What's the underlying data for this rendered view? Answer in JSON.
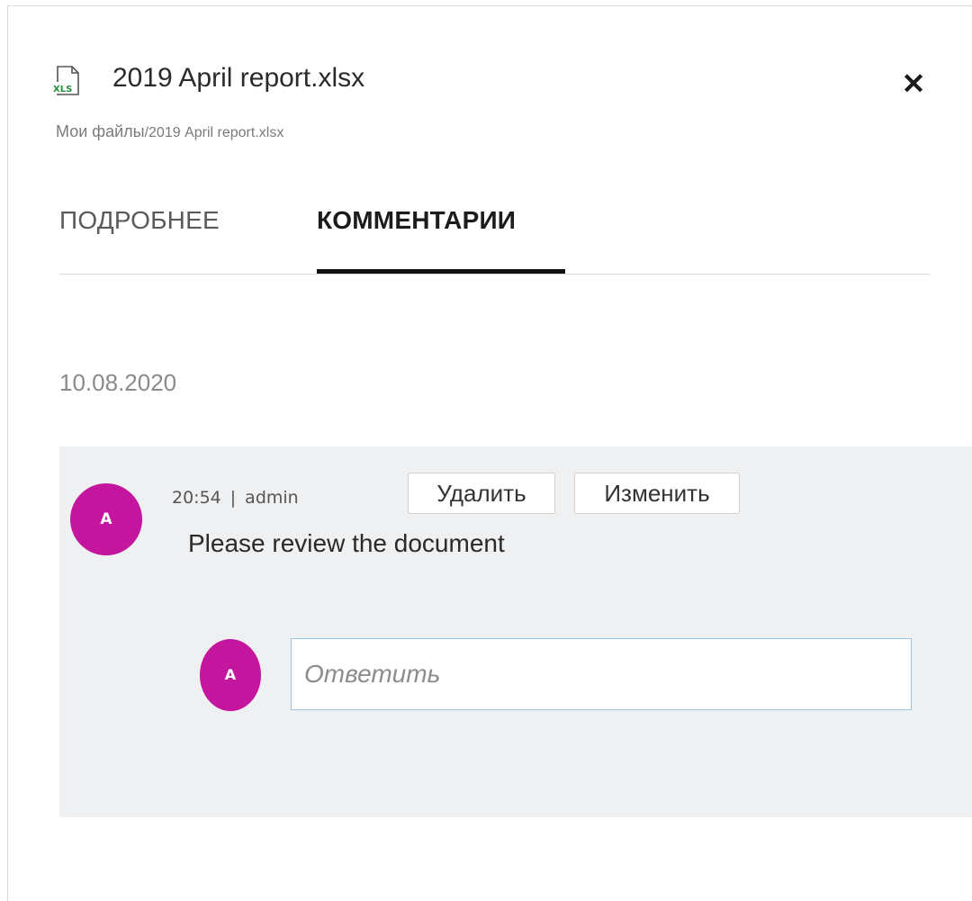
{
  "header": {
    "file_icon": "xls-file-icon",
    "file_icon_label": "XLS",
    "file_name": "2019 April report.xlsx",
    "close_icon": "close-icon"
  },
  "breadcrumb": {
    "root": "Мои файлы",
    "path": "/2019 April report.xlsx"
  },
  "tabs": [
    {
      "label": "ПОДРОБНЕЕ",
      "active": false
    },
    {
      "label": "КОММЕНТАРИИ",
      "active": true
    }
  ],
  "comments": {
    "date": "10.08.2020",
    "items": [
      {
        "avatar_initial": "A",
        "time": "20:54",
        "author": "admin",
        "text": "Please review the document",
        "delete_label": "Удалить",
        "edit_label": "Изменить"
      }
    ],
    "reply": {
      "avatar_initial": "A",
      "placeholder": "Ответить"
    }
  },
  "colors": {
    "avatar": "#c3159d",
    "comment_bg": "#eff0f2",
    "input_border": "#9cc4ea"
  }
}
